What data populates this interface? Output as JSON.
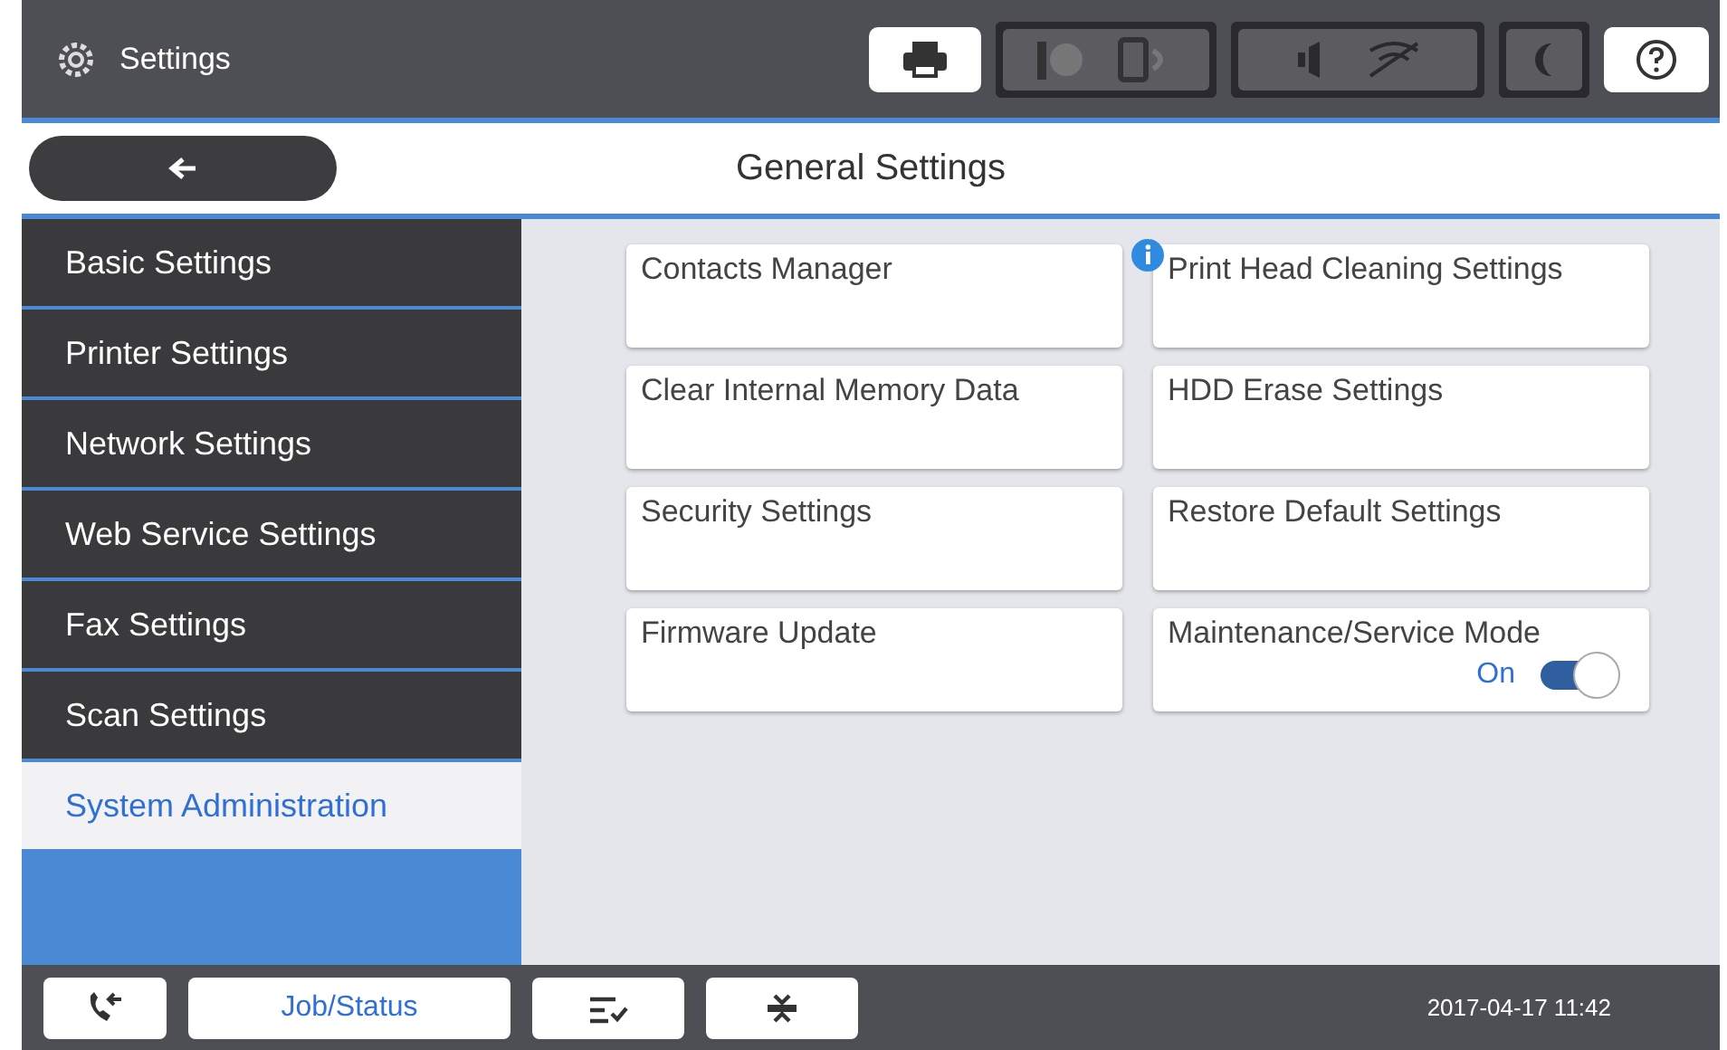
{
  "header": {
    "title": "Settings"
  },
  "screen": {
    "title": "General Settings"
  },
  "sidebar": {
    "items": [
      {
        "label": "Basic Settings",
        "selected": false
      },
      {
        "label": "Printer Settings",
        "selected": false
      },
      {
        "label": "Network Settings",
        "selected": false
      },
      {
        "label": "Web Service Settings",
        "selected": false
      },
      {
        "label": "Fax Settings",
        "selected": false
      },
      {
        "label": "Scan Settings",
        "selected": false
      },
      {
        "label": "System Administration",
        "selected": true
      }
    ]
  },
  "cards": [
    {
      "label": "Contacts Manager",
      "kind": "plain",
      "info": false
    },
    {
      "label": "Print Head Cleaning Settings",
      "kind": "plain",
      "info": true
    },
    {
      "label": "Clear Internal Memory Data",
      "kind": "plain",
      "info": false
    },
    {
      "label": "HDD Erase Settings",
      "kind": "plain",
      "info": false
    },
    {
      "label": "Security Settings",
      "kind": "plain",
      "info": false
    },
    {
      "label": "Restore Default Settings",
      "kind": "plain",
      "info": false
    },
    {
      "label": "Firmware Update",
      "kind": "plain",
      "info": false
    },
    {
      "label": "Maintenance/Service Mode",
      "kind": "toggle",
      "info": false,
      "on": true,
      "state_label": "On"
    }
  ],
  "footer": {
    "job_status": "Job/Status",
    "datetime": "2017-04-17 11:42"
  }
}
